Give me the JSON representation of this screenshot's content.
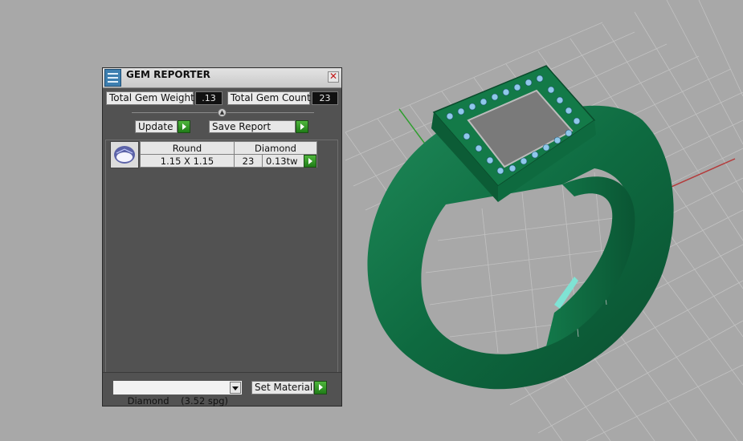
{
  "panel": {
    "title": "GEM REPORTER",
    "close_glyph": "✕",
    "icon": "gem-reporter-app-icon",
    "total_gem_weight_label": "Total Gem Weight",
    "total_gem_weight_value": ".13",
    "total_gem_count_label": "Total Gem Count",
    "total_gem_count_value": "23",
    "splitter_glyph": "▲",
    "update_label": "Update",
    "save_report_label": "Save Report",
    "gems": [
      {
        "shape": "Round",
        "material": "Diamond",
        "size": "1.15 X 1.15",
        "count": "23",
        "weight": "0.13tw"
      }
    ],
    "material_select_value": "Diamond    (3.52 spg)",
    "set_material_label": "Set Material"
  },
  "colors": {
    "panel_bg": "#525252",
    "go_button": "#2e9a24",
    "ring_metal": "#0f7044",
    "gems": "#8ec8ea",
    "viewport_bg": "#a8a8a8"
  }
}
